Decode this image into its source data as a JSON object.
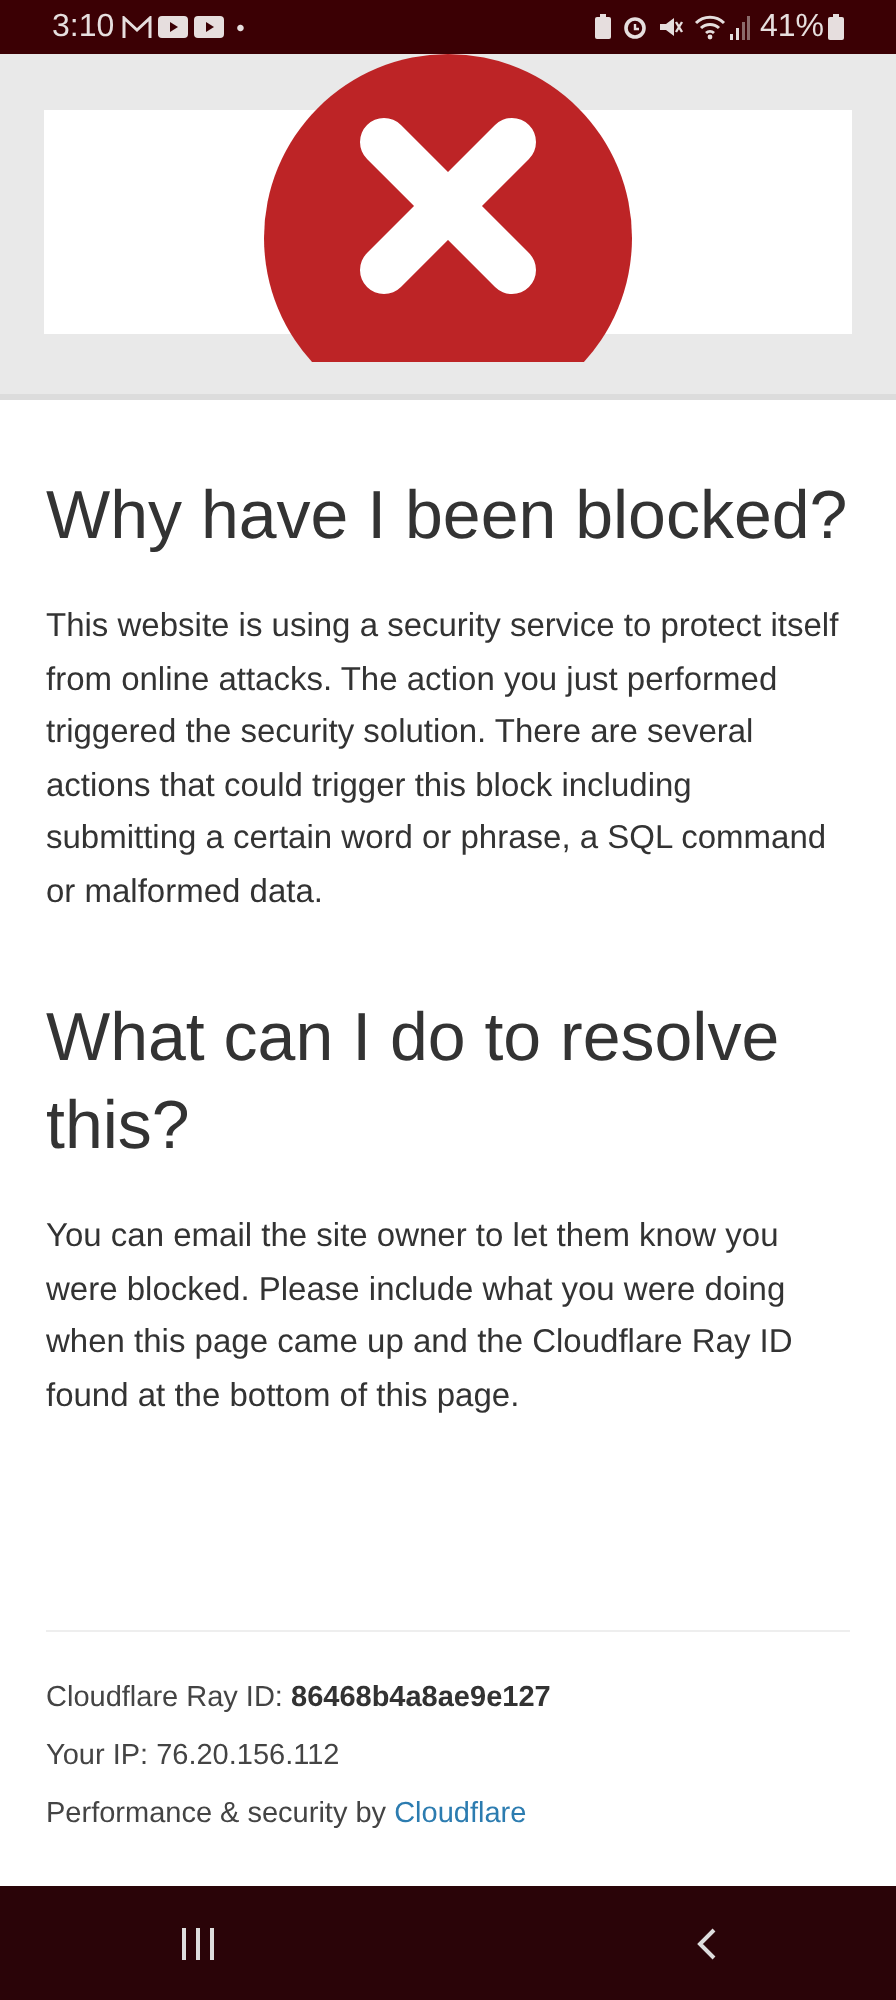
{
  "status_bar": {
    "time": "3:10",
    "dot": "•",
    "battery_percent": "41%"
  },
  "sections": [
    {
      "heading": "Why have I been blocked?",
      "body": "This website is using a security service to protect itself from online attacks. The action you just performed triggered the security solution. There are several actions that could trigger this block including submitting a certain word or phrase, a SQL command or malformed data."
    },
    {
      "heading": "What can I do to resolve this?",
      "body": "You can email the site owner to let them know you were blocked. Please include what you were doing when this page came up and the Cloudflare Ray ID found at the bottom of this page."
    }
  ],
  "footer": {
    "ray_label": "Cloudflare Ray ID:",
    "ray_id": "86468b4a8ae9e127",
    "ip": "Your IP: 76.20.156.112",
    "credit": "Performance & security by",
    "credit_link": "Cloudflare"
  }
}
